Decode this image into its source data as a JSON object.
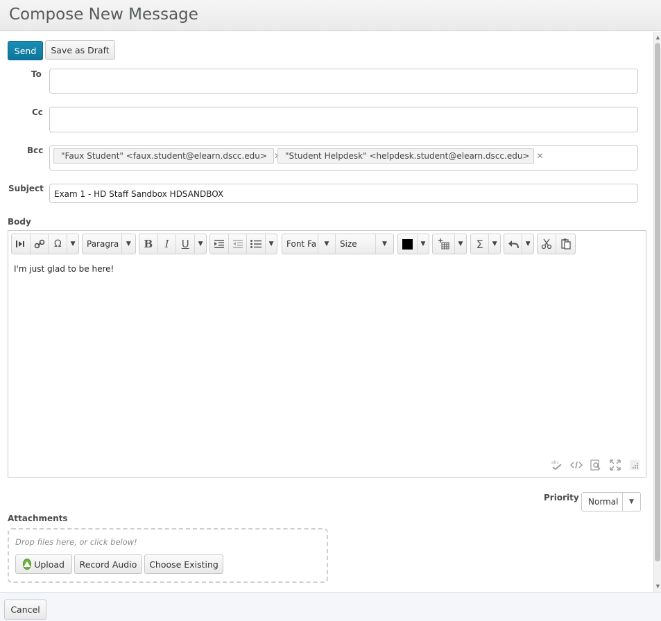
{
  "page_title": "Compose New Message",
  "actions": {
    "send_label": "Send",
    "draft_label": "Save as Draft"
  },
  "fields": {
    "to_label": "To",
    "cc_label": "Cc",
    "bcc_label": "Bcc",
    "bcc_recipients": [
      "\"Faux Student\" <faux.student@elearn.dscc.edu>",
      "\"Student Helpdesk\" <helpdesk.student@elearn.dscc.edu>"
    ],
    "remove_glyph": "✕",
    "subject_label": "Subject",
    "subject_value": "Exam 1 - HD Staff Sandbox HDSANDBOX"
  },
  "body": {
    "label": "Body",
    "text": "I'm just glad to be here!",
    "toolbar": {
      "paragraph_select": "Paragra",
      "font_select": "Font Fa",
      "size_select": "Size",
      "text_color": "#000000"
    }
  },
  "priority": {
    "label": "Priority",
    "value": "Normal"
  },
  "attachments": {
    "label": "Attachments",
    "drop_hint": "Drop files here, or click below!",
    "upload_label": "Upload",
    "record_label": "Record Audio",
    "existing_label": "Choose Existing"
  },
  "footer": {
    "cancel_label": "Cancel"
  },
  "colors": {
    "primary": "#1183a9",
    "upload_icon": "#6db33f"
  }
}
